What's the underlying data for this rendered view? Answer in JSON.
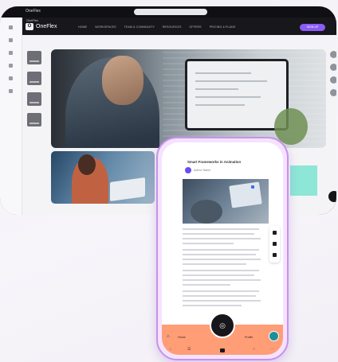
{
  "desktop": {
    "window_title": "OneFlex",
    "brand_label": "OneFlex",
    "brand_logo_letter": "O",
    "nav_items": [
      "HOME",
      "WORKSPACES",
      "TEAM & COMMUNITY",
      "RESOURCES",
      "OFFERS",
      "PRICING & PLANS"
    ],
    "cta_label": "SIGN UP"
  },
  "phone": {
    "article_title": "Smart Frameworks in Animation",
    "author_name": "Author Name",
    "bottom_nav": {
      "left_label": "Home",
      "right_label": "Profile"
    }
  },
  "colors": {
    "accent_purple": "#8b5cf6",
    "phone_frame": "#f5e2ff",
    "phone_border": "#c792ea",
    "bottom_nav": "#ff9d76",
    "teal_block": "#8ee6d7"
  },
  "icons": [
    "grid-icon",
    "home-icon",
    "menu-icon",
    "ellipsis-icon",
    "user-avatar-icon",
    "stop-icon"
  ]
}
